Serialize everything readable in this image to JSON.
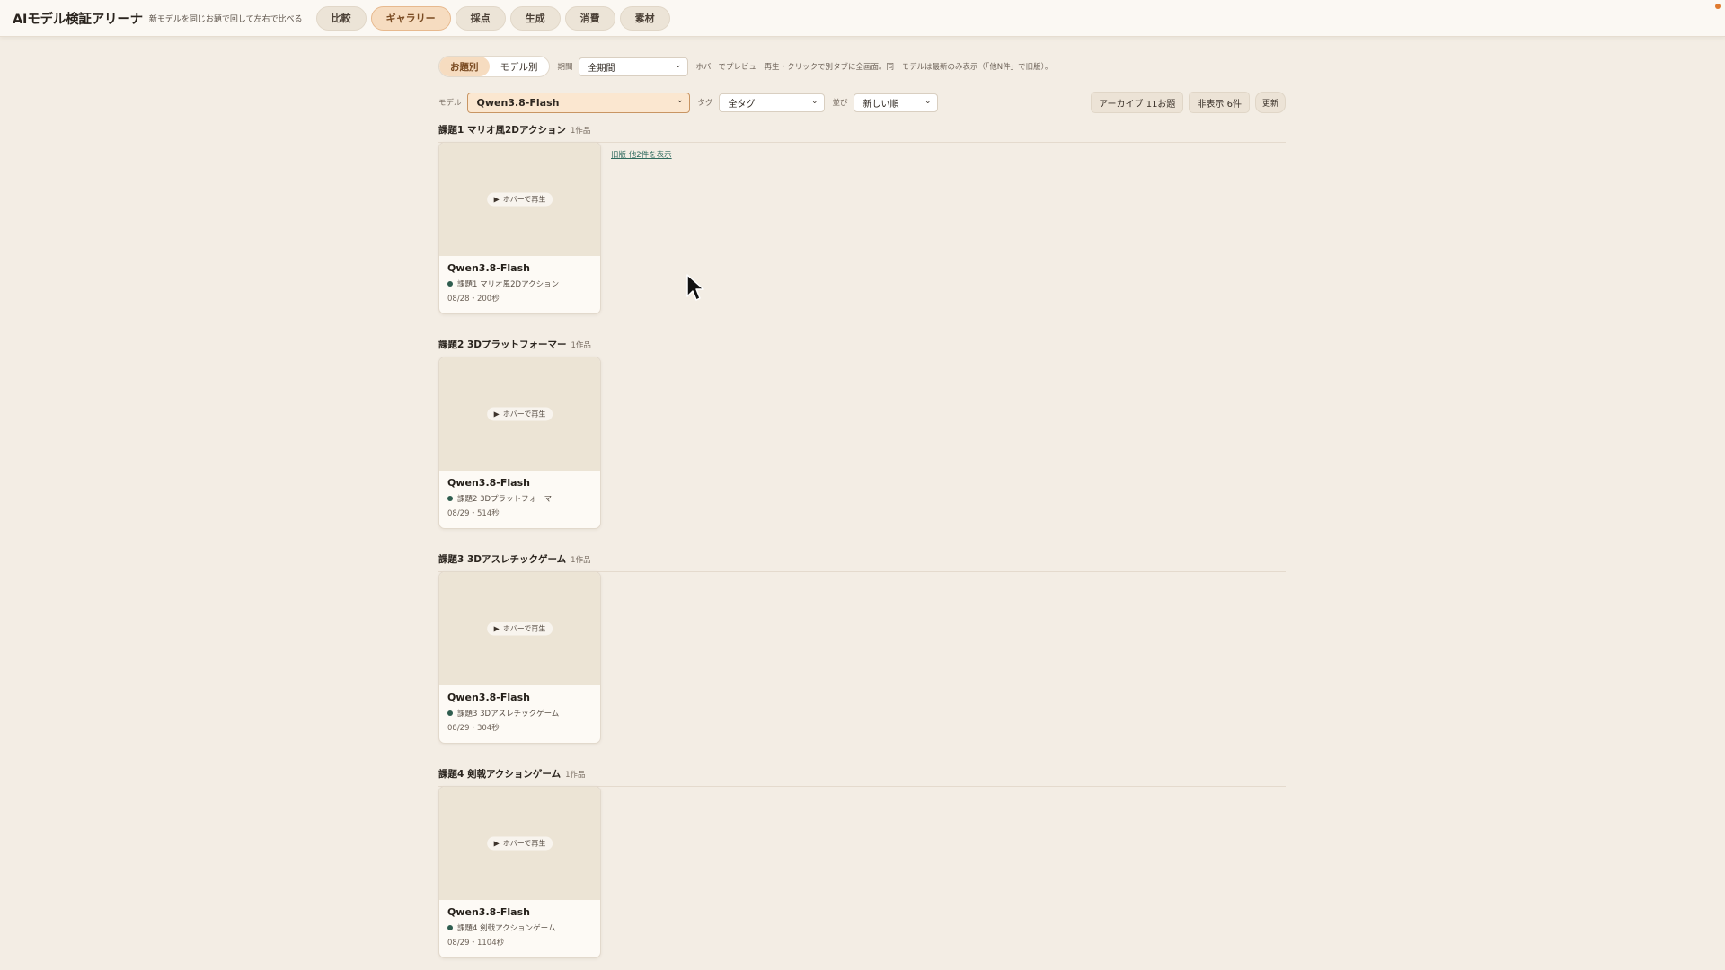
{
  "app": {
    "title": "AIモデル検証アリーナ",
    "subtitle": "新モデルを同じお題で回して左右で比べる"
  },
  "nav": {
    "items": [
      {
        "label": "比較",
        "active": false
      },
      {
        "label": "ギャラリー",
        "active": true
      },
      {
        "label": "採点",
        "active": false
      },
      {
        "label": "生成",
        "active": false
      },
      {
        "label": "消費",
        "active": false
      },
      {
        "label": "素材",
        "active": false
      }
    ]
  },
  "filters": {
    "view_tabs": [
      {
        "label": "お題別",
        "active": true
      },
      {
        "label": "モデル別",
        "active": false
      }
    ],
    "period_label": "期間",
    "period_value": "全期間",
    "hint": "ホバーでプレビュー再生・クリックで別タブに全画面。同一モデルは最新のみ表示（「他N件」で旧版）。",
    "model_label": "モデル",
    "model_value": "Qwen3.8-Flash",
    "tag_label": "タグ",
    "tag_value": "全タグ",
    "sort_label": "並び",
    "sort_value": "新しい順",
    "archive_button": "アーカイブ 11お題",
    "hidden_button": "非表示 6件",
    "refresh_button": "更新"
  },
  "sections": [
    {
      "title": "課題1 マリオ風2Dアクション",
      "count": "1作品",
      "old_link": "旧版 他2件を表示",
      "card": {
        "play": "ホバーで再生",
        "model": "Qwen3.8-Flash",
        "task": "課題1 マリオ風2Dアクション",
        "meta": "08/28・200秒"
      }
    },
    {
      "title": "課題2 3Dプラットフォーマー",
      "count": "1作品",
      "card": {
        "play": "ホバーで再生",
        "model": "Qwen3.8-Flash",
        "task": "課題2 3Dプラットフォーマー",
        "meta": "08/29・514秒"
      }
    },
    {
      "title": "課題3 3Dアスレチックゲーム",
      "count": "1作品",
      "card": {
        "play": "ホバーで再生",
        "model": "Qwen3.8-Flash",
        "task": "課題3 3Dアスレチックゲーム",
        "meta": "08/29・304秒"
      }
    },
    {
      "title": "課題4 剣戟アクションゲーム",
      "count": "1作品",
      "card": {
        "play": "ホバーで再生",
        "model": "Qwen3.8-Flash",
        "task": "課題4 剣戟アクションゲーム",
        "meta": "08/29・1104秒"
      }
    }
  ],
  "colors": {
    "background": "#f3ede4",
    "accent": "#f6dcc0",
    "status_dot": "#2f5d4f",
    "link": "#2f6a5e"
  }
}
